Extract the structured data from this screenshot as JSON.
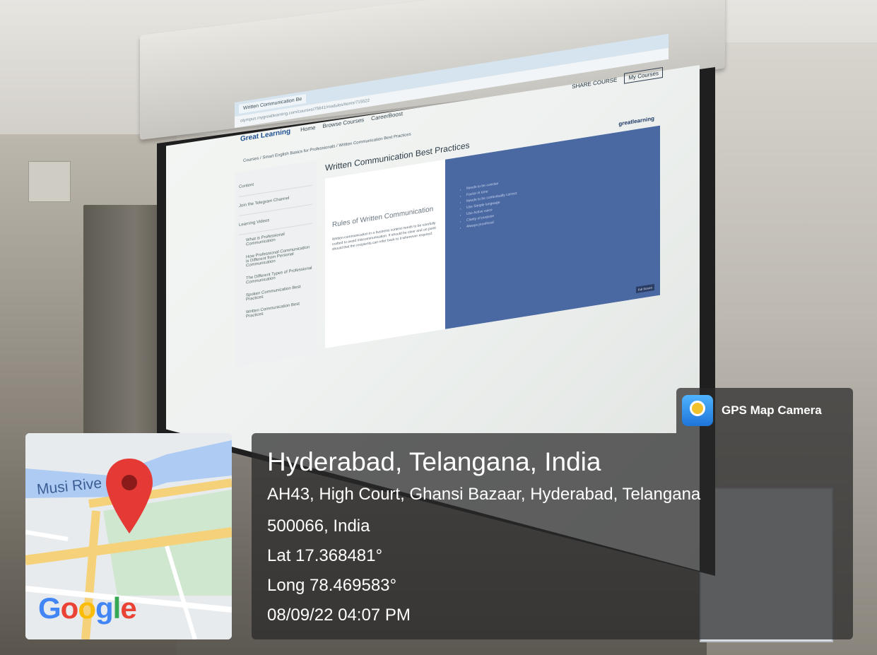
{
  "browser": {
    "tab_label": "Written Communication Be",
    "url": "olympus.mygreatlearning.com/courses/75641/modules/items/715522",
    "logo": "Great Learning",
    "nav": [
      "Home",
      "Browse Courses",
      "CareerBoost"
    ],
    "my_courses": "My Courses",
    "share": "SHARE COURSE",
    "breadcrumb": "Courses / Smart English Basics for Professionals / Written Communication Best Practices",
    "sidebar": {
      "content": "Content",
      "telegram": "Join the Telegram Channel",
      "learning_videos": "Learning Videos",
      "items": [
        "What is Professional Communication",
        "How Professional Communication is Different from Personal Communication",
        "The Different Types of Professional Communication",
        "Spoken Communication Best Practices",
        "Written Communication Best Practices"
      ]
    },
    "lesson_title": "Written Communication Best Practices",
    "slide": {
      "brand": "greatlearning",
      "heading": "Rules of Written Communication",
      "text": "Written communication in a business context needs to be carefully crafted to avoid miscommunication. It should be clear and on point should that the recipients can refer back to it whenever required.",
      "bullets": [
        "Needs to be concise",
        "Factor in tone",
        "Needs to be contextually correct",
        "Use Simple language",
        "Use Active voice",
        "Clarity of purpose",
        "Always proofread"
      ],
      "fullscreen": "Full Screen"
    }
  },
  "overlay": {
    "app_name": "GPS Map Camera",
    "place": "Hyderabad, Telangana, India",
    "address_line1": "AH43, High Court, Ghansi Bazaar, Hyderabad, Telangana",
    "address_line2": "500066, India",
    "lat": "Lat 17.368481°",
    "long": "Long 78.469583°",
    "datetime": "08/09/22 04:07 PM"
  },
  "map": {
    "river_label": "Musi Rive",
    "provider": "Google",
    "pin_color": "#e53935"
  }
}
